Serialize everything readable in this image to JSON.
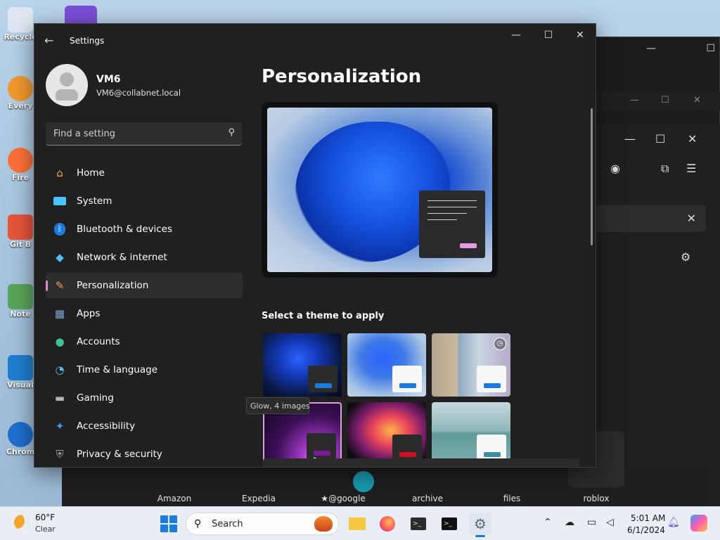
{
  "desktop": {
    "icons": [
      {
        "label": "Recycle"
      },
      {
        "label": "Every"
      },
      {
        "label": "Fire"
      },
      {
        "label": "Git B"
      },
      {
        "label": "Note"
      },
      {
        "label": "Visual"
      },
      {
        "label": "Chrom"
      }
    ]
  },
  "background": {
    "shortcuts": [
      "Amazon",
      "Expedia",
      "@google",
      "archive",
      "files",
      "roblox"
    ]
  },
  "settings": {
    "title": "Settings",
    "profile": {
      "name": "VM6",
      "email": "VM6@collabnet.local"
    },
    "search_placeholder": "Find a setting",
    "nav": [
      {
        "label": "Home",
        "icon": "home-icon",
        "color": "#f4a94a"
      },
      {
        "label": "System",
        "icon": "system-icon",
        "color": "#4cc2ff"
      },
      {
        "label": "Bluetooth & devices",
        "icon": "bluetooth-icon",
        "color": "#1b7be0"
      },
      {
        "label": "Network & internet",
        "icon": "wifi-icon",
        "color": "#4cc2ff"
      },
      {
        "label": "Personalization",
        "icon": "brush-icon",
        "color": "#f0a35a",
        "active": true
      },
      {
        "label": "Apps",
        "icon": "apps-icon",
        "color": "#7aa7d8"
      },
      {
        "label": "Accounts",
        "icon": "accounts-icon",
        "color": "#3fc29a"
      },
      {
        "label": "Time & language",
        "icon": "clock-globe-icon",
        "color": "#4cc2ff"
      },
      {
        "label": "Gaming",
        "icon": "gamepad-icon",
        "color": "#b5b5b5"
      },
      {
        "label": "Accessibility",
        "icon": "accessibility-icon",
        "color": "#3aa0f0"
      },
      {
        "label": "Privacy & security",
        "icon": "shield-icon",
        "color": "#a0a0a0"
      }
    ],
    "page_title": "Personalization",
    "themes_label": "Select a theme to apply",
    "tooltip": "Glow, 4 images"
  },
  "taskbar": {
    "weather": {
      "temp": "60°F",
      "condition": "Clear"
    },
    "search_label": "Search",
    "time": "5:01 AM",
    "date": "6/1/2024"
  },
  "colors": {
    "accent": "#d78ed7",
    "taskbar_accent": "#1b7be0"
  }
}
